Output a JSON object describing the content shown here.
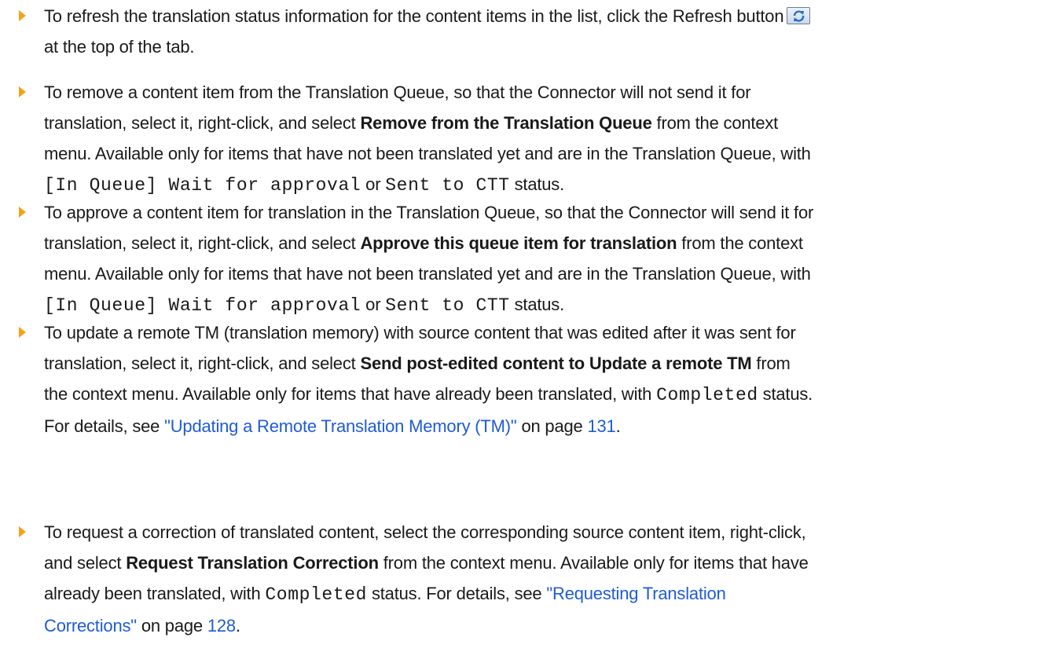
{
  "bullets": [
    {
      "l1_a": "To refresh the translation status information for the content items in the list, click the Refresh button",
      "refresh_icon": "refresh-icon",
      "l2": "at the top of the tab."
    },
    {
      "l1": "To remove a content item from the Translation Queue, so that the Connector will not send it for",
      "l2_a": "translation, select it, right-click, and select ",
      "l2_bold": "Remove from the Translation Queue",
      "l2_b": " from the context",
      "l3": "menu. Available only for items that have not been translated yet and are in the Translation Queue, with",
      "l4_code1": "[In Queue] Wait for approval",
      "l4_or": " or ",
      "l4_code2": "Sent to CTT",
      "l4_end": " status."
    },
    {
      "l1": "To approve a content item for translation in the Translation Queue, so that the Connector will send it for",
      "l2_a": "translation, select it, right-click, and select ",
      "l2_bold": "Approve this queue item for translation",
      "l2_b": " from the context",
      "l3": "menu. Available only for items that have not been translated yet and are in the Translation Queue, with",
      "l4_code1": "[In Queue] Wait for approval",
      "l4_or": " or ",
      "l4_code2": "Sent to CTT",
      "l4_end": " status."
    },
    {
      "l1": "To update a remote TM (translation memory) with source content that was edited after it was sent for",
      "l2_a": "translation, select it, right-click, and select ",
      "l2_bold": "Send post-edited content to Update a remote TM",
      "l2_b": " from",
      "l3_a": "the context menu. Available only for items that have already been translated, with ",
      "l3_code": "Completed",
      "l3_b": " status.",
      "l4_a": "For details, see ",
      "l4_link": "\"Updating a Remote Translation Memory (TM)\"",
      "l4_b": " on page ",
      "l4_page": "131",
      "l4_end": "."
    },
    {
      "l1": "To request a correction of translated content, select the corresponding source content item, right-click,",
      "l2_a": "and select ",
      "l2_bold": "Request Translation Correction",
      "l2_b": " from the context menu. Available only for items that have",
      "l3_a": "already been translated, with ",
      "l3_code": "Completed",
      "l3_b": " status. For details, see ",
      "l3_link": "\"Requesting Translation",
      "l4_link": "Corrections\"",
      "l4_b": " on page ",
      "l4_page": "128",
      "l4_end": "."
    }
  ],
  "colors": {
    "bullet": "#f5a21b",
    "link": "#1f5bd6",
    "text": "#1a1a1a"
  }
}
